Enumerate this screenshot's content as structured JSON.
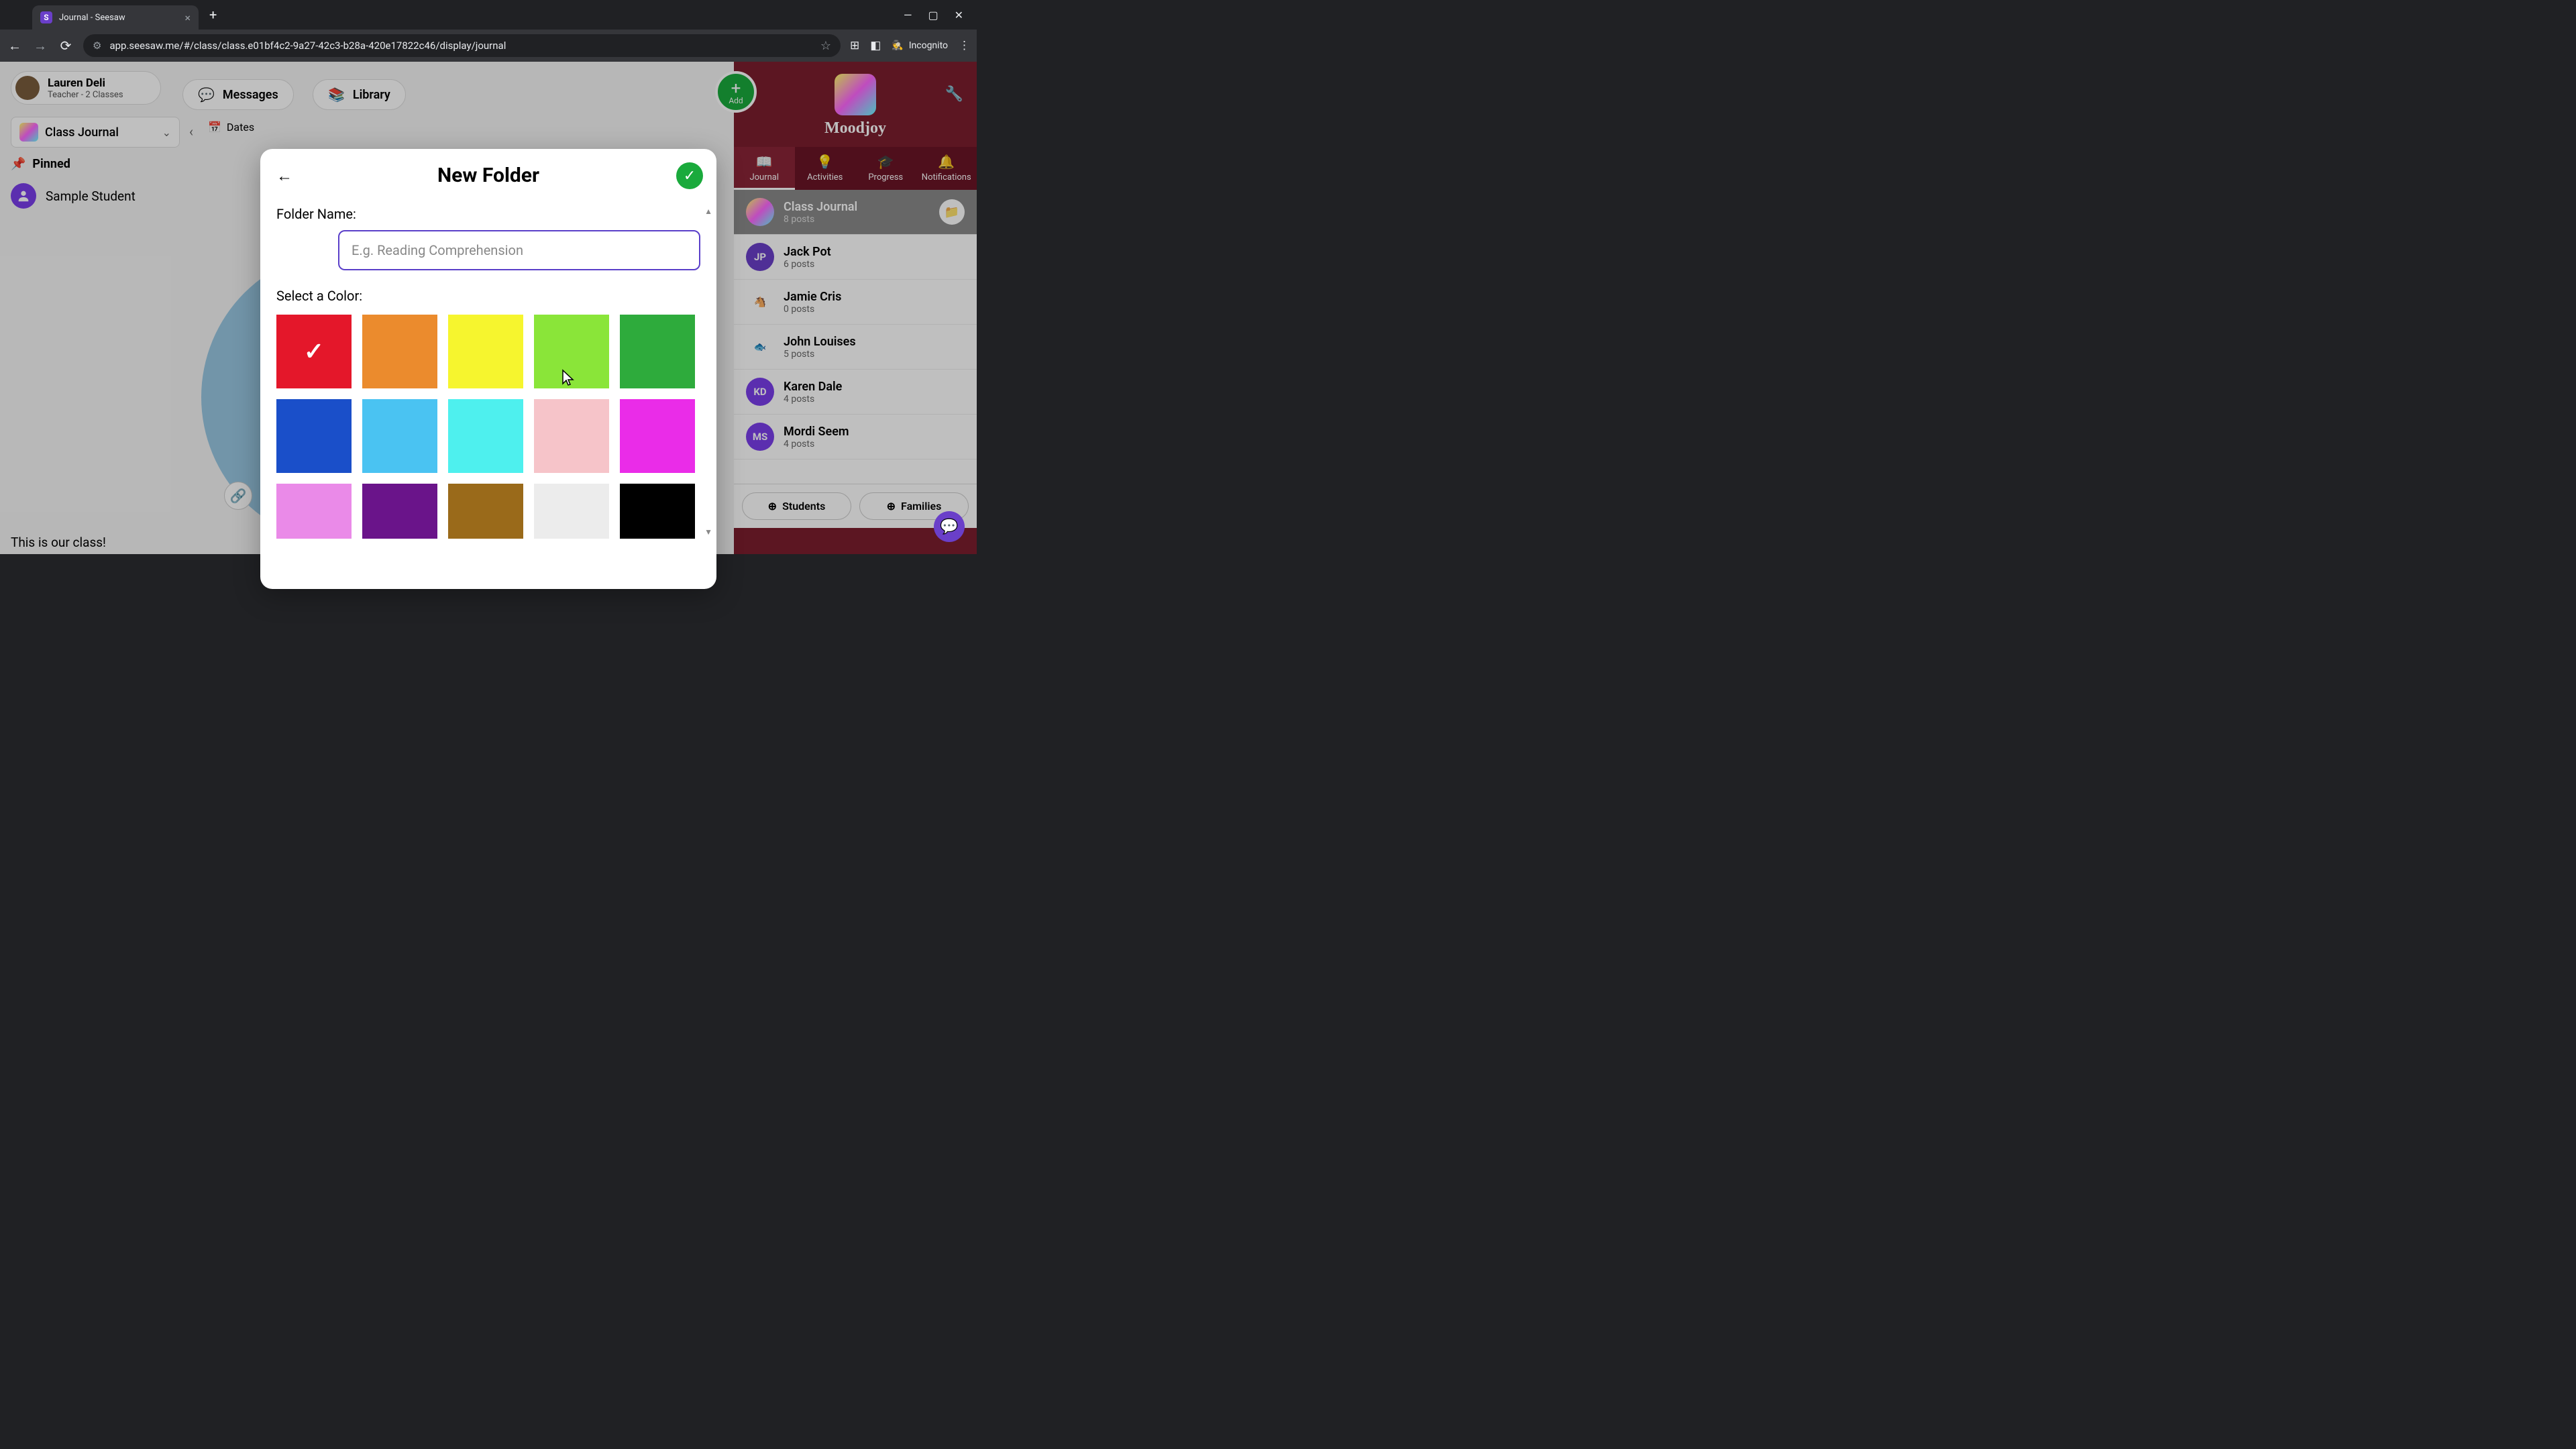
{
  "browser": {
    "tab_title": "Journal - Seesaw",
    "url": "app.seesaw.me/#/class/class.e01bf4c2-9a27-42c3-b28a-420e17822c46/display/journal",
    "incognito_label": "Incognito"
  },
  "user": {
    "name": "Lauren Deli",
    "subtitle": "Teacher - 2 Classes"
  },
  "top_nav": {
    "messages": "Messages",
    "library": "Library"
  },
  "journal_selector": {
    "label": "Class Journal",
    "dates": "Dates"
  },
  "pinned_label": "Pinned",
  "sample_student": "Sample Student",
  "caption": "This is our class!",
  "add_label": "Add",
  "class_name": "Moodjoy",
  "right_tabs": {
    "journal": "Journal",
    "activities": "Activities",
    "progress": "Progress",
    "notifications": "Notifications"
  },
  "student_list": [
    {
      "name": "Class Journal",
      "sub": "8 posts",
      "avatar": "",
      "selected": true
    },
    {
      "name": "Jack Pot",
      "sub": "6 posts",
      "avatar": "JP"
    },
    {
      "name": "Jamie Cris",
      "sub": "0 posts",
      "avatar": "🐴"
    },
    {
      "name": "John Louises",
      "sub": "5 posts",
      "avatar": "🐟"
    },
    {
      "name": "Karen Dale",
      "sub": "4 posts",
      "avatar": "KD"
    },
    {
      "name": "Mordi Seem",
      "sub": "4 posts",
      "avatar": "MS"
    }
  ],
  "bottom_actions": {
    "students": "Students",
    "families": "Families"
  },
  "modal": {
    "title": "New Folder",
    "folder_name_label": "Folder Name:",
    "folder_name_placeholder": "E.g. Reading Comprehension",
    "select_color_label": "Select a Color:",
    "colors": {
      "red": "#e4172a",
      "orange": "#eb8b2d",
      "yellow": "#f6f52e",
      "lime": "#8ae539",
      "green": "#2eab3c",
      "blue": "#1a4fc9",
      "skyblue": "#4ac3f2",
      "cyan": "#4ef0ee",
      "pink": "#f6c4c9",
      "magenta": "#ea2ce8",
      "lightpink": "#ea8ae8",
      "purple": "#6a148a",
      "brown": "#9a6a1a",
      "lightgray": "#ececec",
      "black": "#000000"
    },
    "selected_color": "red"
  }
}
